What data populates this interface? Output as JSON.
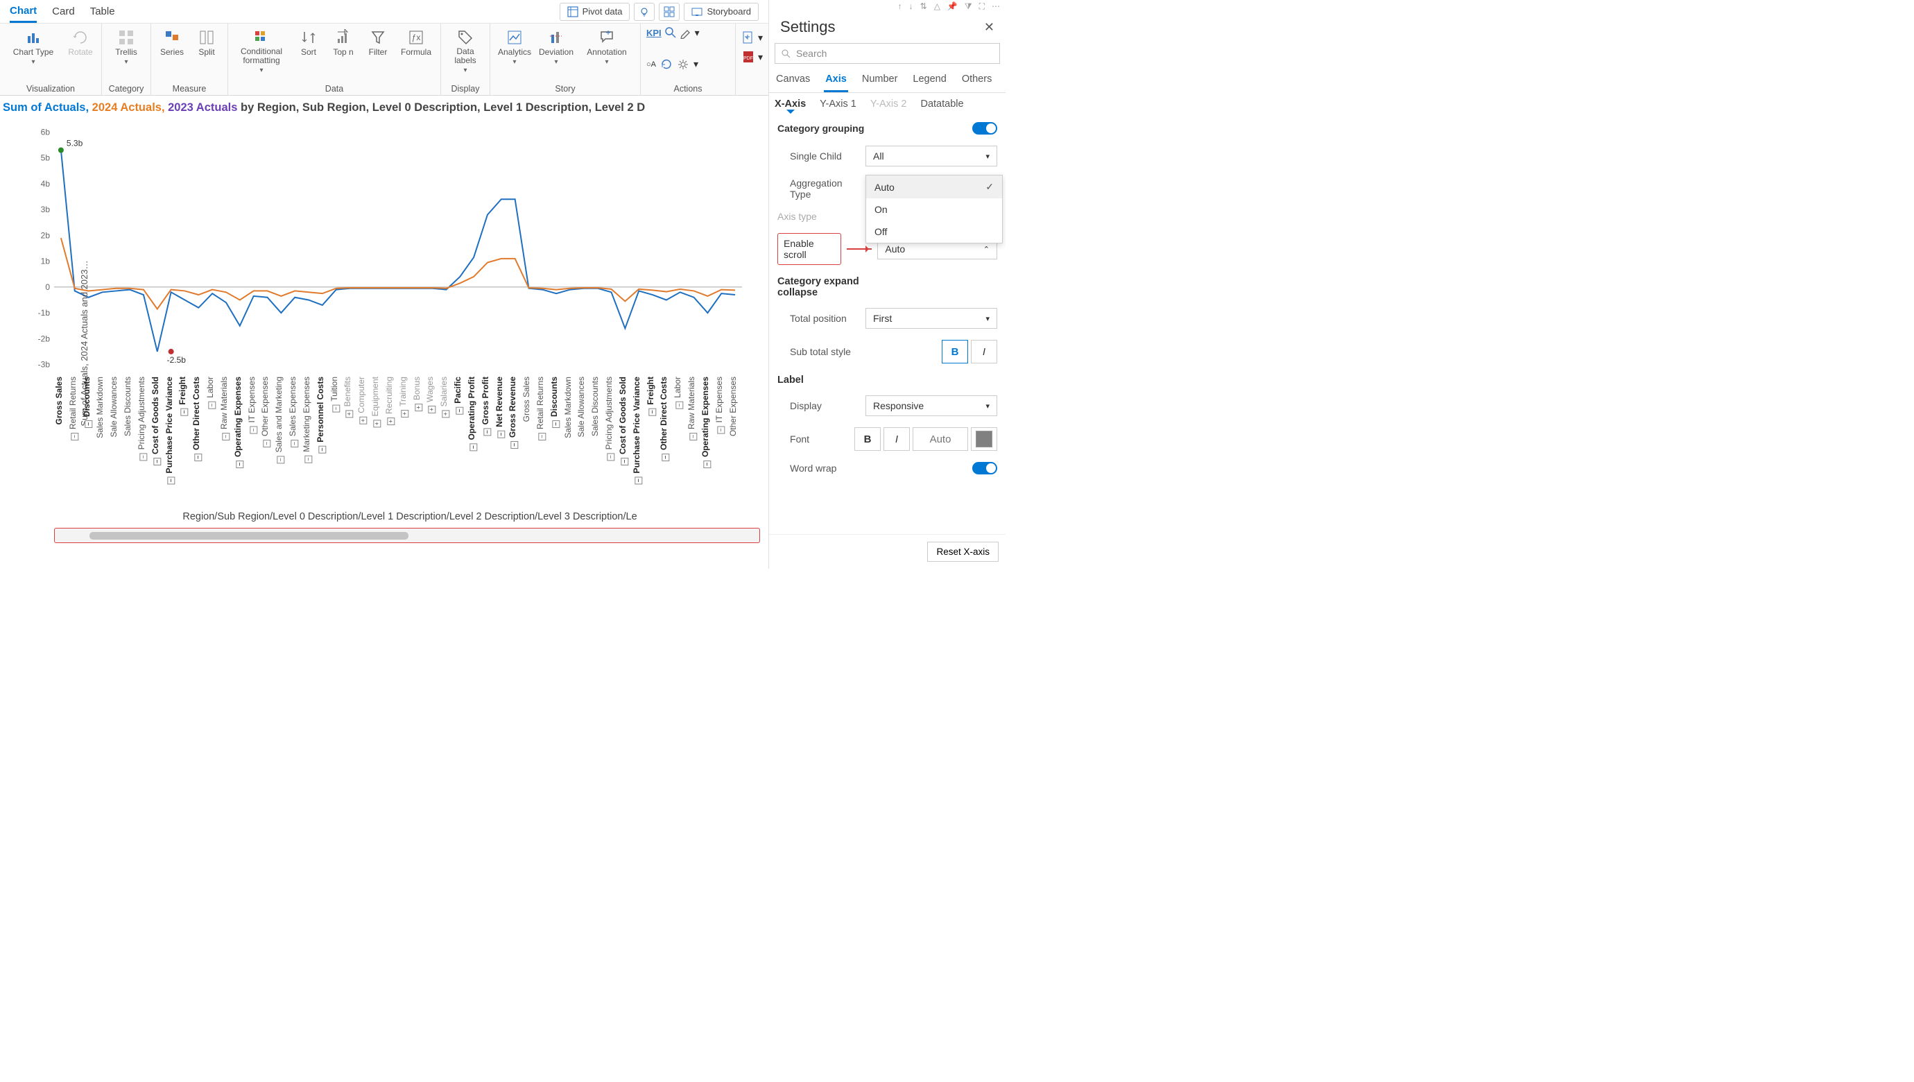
{
  "topTabs": {
    "chart": "Chart",
    "card": "Card",
    "table": "Table"
  },
  "topPills": {
    "pivot": "Pivot data",
    "storyboard": "Storyboard"
  },
  "ribbon": {
    "visualization": {
      "label": "Visualization",
      "chartType": "Chart Type",
      "rotate": "Rotate"
    },
    "category": {
      "label": "Category",
      "trellis": "Trellis"
    },
    "measure": {
      "label": "Measure",
      "series": "Series",
      "split": "Split"
    },
    "data": {
      "label": "Data",
      "cond": "Conditional formatting",
      "sort": "Sort",
      "topn": "Top n",
      "filter": "Filter",
      "formula": "Formula"
    },
    "display": {
      "label": "Display",
      "datalabels": "Data labels"
    },
    "story": {
      "label": "Story",
      "analytics": "Analytics",
      "deviation": "Deviation",
      "annotation": "Annotation"
    },
    "actions": {
      "label": "Actions",
      "kpi": "KPI",
      "a": "A"
    }
  },
  "chartTitle": {
    "s1": "Sum of Actuals, ",
    "s2": "2024 Actuals, ",
    "s3": "2023 Actuals ",
    "rest": "by Region, Sub Region, Level 0 Description, Level 1 Description, Level 2 D"
  },
  "yLabel": "Sum of Actuals, 2024 Actuals and 2023…",
  "xTitle": "Region/Sub Region/Level 0 Description/Level 1 Description/Level 2 Description/Level 3 Description/Le",
  "dataLabels": {
    "max": "5.3b",
    "min": "-2.5b"
  },
  "yTicks": [
    "6b",
    "5b",
    "4b",
    "3b",
    "2b",
    "1b",
    "0",
    "-1b",
    "-2b",
    "-3b"
  ],
  "chart_data": {
    "type": "line",
    "ylabel": "Sum of Actuals, 2024 Actuals and 2023…",
    "xlabel": "Region/Sub Region/Level 0 Description/Level 1 Description/Level 2 Description/Level 3 Description/Le",
    "ylim": [
      -3.2,
      6.2
    ],
    "yunit": "b",
    "categories": [
      {
        "label": "Gross Sales",
        "bold": true
      },
      {
        "label": "Retail Returns",
        "tg": "-"
      },
      {
        "label": "Discounts",
        "bold": true,
        "tg": "-"
      },
      {
        "label": "Sales Markdown"
      },
      {
        "label": "Sale Allowances"
      },
      {
        "label": "Sales Discounts"
      },
      {
        "label": "Pricing Adjustments",
        "tg": "-"
      },
      {
        "label": "Cost of Goods Sold",
        "bold": true,
        "tg": "-"
      },
      {
        "label": "Purchase Price Variance",
        "bold": true,
        "tg": "-"
      },
      {
        "label": "Freight",
        "bold": true,
        "tg": "-"
      },
      {
        "label": "Other Direct Costs",
        "bold": true,
        "tg": "-"
      },
      {
        "label": "Labor",
        "tg": "-"
      },
      {
        "label": "Raw Materials",
        "tg": "-"
      },
      {
        "label": "Operating Expenses",
        "bold": true,
        "tg": "-"
      },
      {
        "label": "IT Expenses",
        "tg": "-"
      },
      {
        "label": "Other Expenses",
        "tg": "-"
      },
      {
        "label": "Sales and Marketing",
        "tg": "-"
      },
      {
        "label": "Sales Expenses",
        "tg": "-"
      },
      {
        "label": "Marketing Expenses",
        "tg": "-"
      },
      {
        "label": "Personnel Costs",
        "bold": true,
        "tg": "-"
      },
      {
        "label": "Tuition",
        "tg": "-"
      },
      {
        "label": "Benefits",
        "grey": true,
        "tg": "+"
      },
      {
        "label": "Computer",
        "grey": true,
        "tg": "+"
      },
      {
        "label": "Equipment",
        "grey": true,
        "tg": "+"
      },
      {
        "label": "Recruiting",
        "grey": true,
        "tg": "+"
      },
      {
        "label": "Training",
        "grey": true,
        "tg": "+"
      },
      {
        "label": "Bonus",
        "grey": true,
        "tg": "+"
      },
      {
        "label": "Wages",
        "grey": true,
        "tg": "+"
      },
      {
        "label": "Salaries",
        "grey": true,
        "tg": "+"
      },
      {
        "label": "Pacific",
        "bold": true,
        "tg": "-"
      },
      {
        "label": "Operating Profit",
        "bold": true,
        "tg": "-"
      },
      {
        "label": "Gross Profit",
        "bold": true,
        "tg": "-"
      },
      {
        "label": "Net Revenue",
        "bold": true,
        "tg": "-"
      },
      {
        "label": "Gross Revenue",
        "bold": true,
        "tg": "-"
      },
      {
        "label": "Gross Sales"
      },
      {
        "label": "Retail Returns",
        "tg": "-"
      },
      {
        "label": "Discounts",
        "bold": true,
        "tg": "-"
      },
      {
        "label": "Sales Markdown"
      },
      {
        "label": "Sale Allowances"
      },
      {
        "label": "Sales Discounts"
      },
      {
        "label": "Pricing Adjustments",
        "tg": "-"
      },
      {
        "label": "Cost of Goods Sold",
        "bold": true,
        "tg": "-"
      },
      {
        "label": "Purchase Price Variance",
        "bold": true,
        "tg": "-"
      },
      {
        "label": "Freight",
        "bold": true,
        "tg": "-"
      },
      {
        "label": "Other Direct Costs",
        "bold": true,
        "tg": "-"
      },
      {
        "label": "Labor",
        "tg": "-"
      },
      {
        "label": "Raw Materials",
        "tg": "-"
      },
      {
        "label": "Operating Expenses",
        "bold": true,
        "tg": "-"
      },
      {
        "label": "IT Expenses",
        "tg": "-"
      },
      {
        "label": "Other Expenses"
      }
    ],
    "series": [
      {
        "name": "Sum of Actuals",
        "color": "#1e6fc0",
        "values": [
          5.3,
          -0.15,
          -0.4,
          -0.2,
          -0.15,
          -0.1,
          -0.3,
          -2.5,
          -0.2,
          -0.5,
          -0.8,
          -0.25,
          -0.6,
          -1.5,
          -0.35,
          -0.4,
          -1.0,
          -0.4,
          -0.5,
          -0.7,
          -0.1,
          -0.05,
          -0.05,
          -0.05,
          -0.05,
          -0.05,
          -0.05,
          -0.05,
          -0.1,
          0.4,
          1.15,
          2.8,
          3.4,
          3.4,
          -0.05,
          -0.1,
          -0.25,
          -0.1,
          -0.05,
          -0.05,
          -0.2,
          -1.6,
          -0.15,
          -0.3,
          -0.5,
          -0.2,
          -0.4,
          -1.0,
          -0.25,
          -0.3
        ]
      },
      {
        "name": "2024 Actuals",
        "color": "#e07b2e",
        "values": [
          1.9,
          -0.05,
          -0.15,
          -0.1,
          -0.05,
          -0.05,
          -0.1,
          -0.85,
          -0.1,
          -0.15,
          -0.3,
          -0.1,
          -0.2,
          -0.5,
          -0.15,
          -0.15,
          -0.35,
          -0.15,
          -0.2,
          -0.25,
          -0.05,
          -0.03,
          -0.03,
          -0.03,
          -0.03,
          -0.03,
          -0.03,
          -0.03,
          -0.05,
          0.15,
          0.4,
          0.95,
          1.1,
          1.1,
          -0.03,
          -0.05,
          -0.1,
          -0.05,
          -0.03,
          -0.03,
          -0.08,
          -0.55,
          -0.08,
          -0.12,
          -0.18,
          -0.08,
          -0.15,
          -0.35,
          -0.1,
          -0.12
        ]
      }
    ],
    "annotations": {
      "max": {
        "index": 0,
        "value": 5.3,
        "label": "5.3b"
      },
      "min": {
        "index": 8,
        "value": -2.5,
        "label": "-2.5b"
      }
    }
  },
  "settings": {
    "title": "Settings",
    "searchPlaceholder": "Search",
    "tabs": {
      "canvas": "Canvas",
      "axis": "Axis",
      "number": "Number",
      "legend": "Legend",
      "others": "Others"
    },
    "subTabs": {
      "xaxis": "X-Axis",
      "yaxis1": "Y-Axis 1",
      "yaxis2": "Y-Axis 2",
      "datatable": "Datatable"
    },
    "categoryGrouping": "Category grouping",
    "singleChild": {
      "label": "Single Child",
      "value": "All"
    },
    "aggType": {
      "label": "Aggregation Type"
    },
    "axisType": {
      "label": "Axis type"
    },
    "enableScroll": {
      "label": "Enable scroll",
      "value": "Auto"
    },
    "catExpand": "Category expand collapse",
    "totalPos": {
      "label": "Total position",
      "value": "First"
    },
    "subTotalStyle": "Sub total style",
    "labelSection": "Label",
    "display": {
      "label": "Display",
      "value": "Responsive"
    },
    "font": "Font",
    "fontSize": "Auto",
    "wordWrap": "Word wrap",
    "reset": "Reset X-axis",
    "menu": {
      "auto": "Auto",
      "on": "On",
      "off": "Off"
    }
  }
}
